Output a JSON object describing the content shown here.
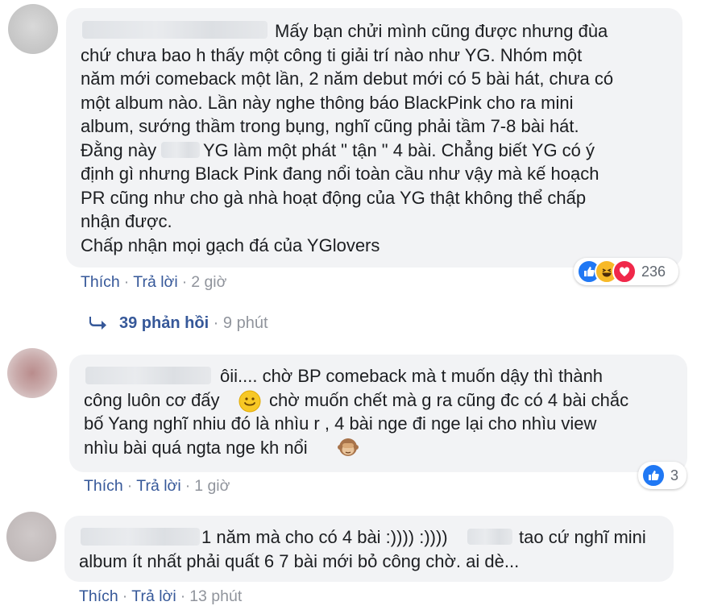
{
  "colors": {
    "link": "#365899",
    "meta": "#90949c",
    "bubble": "#f2f3f5",
    "like_blue": "#2078f4",
    "love_red": "#f0284a",
    "haha_yellow": "#f7b928"
  },
  "comments": [
    {
      "lines": [
        "Mấy bạn chửi mình cũng được nhưng đùa",
        "chứ chưa bao h thấy một công ti giải trí nào như YG. Nhóm một",
        "năm mới comeback một lần, 2 năm debut mới có 5 bài hát, chưa có",
        "một album nào. Lần này nghe thông báo BlackPink cho ra mini",
        "album, sướng thầm trong bụng, nghĩ cũng phải tầm 7-8 bài hát.",
        "YG làm một phát \" tận \" 4 bài. Chẳng biết YG có ý",
        "định gì nhưng Black Pink đang nổi toàn cầu như vậy mà kế hoạch",
        "PR cũng như cho gà nhà hoạt động của YG thật không thể chấp",
        "nhận được.",
        "Chấp nhận mọi gạch đá của YGlovers"
      ],
      "line6_prefix": "Đằng này",
      "like": "Thích",
      "reply": "Trả lời",
      "time": "2 giờ",
      "reaction_icons": [
        "like-icon",
        "haha-icon",
        "love-icon"
      ],
      "reaction_count": "236",
      "replies_label": "39 phản hồi",
      "replies_time": "9 phút"
    },
    {
      "lines": [
        "ôii.... chờ BP comeback mà t muốn dậy thì thành",
        "công luôn cơ đấy",
        "chờ muốn chết mà g ra cũng đc có 4 bài chắc",
        "bố Yang nghĩ nhiu đó là nhìu r , 4 bài nge đi nge lại cho nhìu view",
        "nhìu bài quá ngta nge kh nổi"
      ],
      "like": "Thích",
      "reply": "Trả lời",
      "time": "1 giờ",
      "reaction_icons": [
        "like-icon"
      ],
      "reaction_count": "3"
    },
    {
      "lines": [
        "1 năm mà cho có 4 bài :)))) :))))",
        "tao cứ nghĩ mini",
        "album ít nhất phải quất 6 7 bài mới bỏ công chờ. ai dè..."
      ],
      "like": "Thích",
      "reply": "Trả lời",
      "time": "13 phút"
    }
  ]
}
